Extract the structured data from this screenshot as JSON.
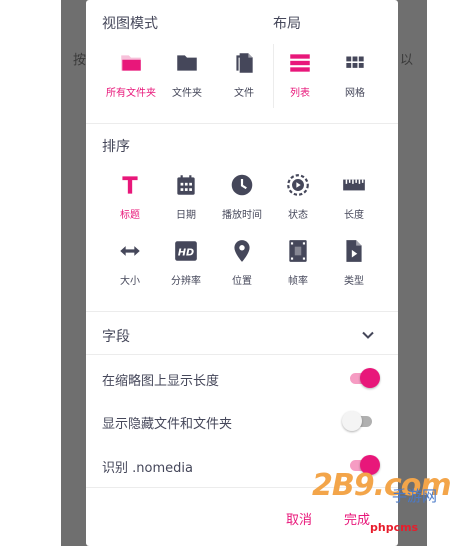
{
  "background": {
    "left_text": "按",
    "right_text": "以"
  },
  "view_mode": {
    "title": "视图模式",
    "items": [
      {
        "label": "所有文件夹",
        "icon": "folder-open-icon",
        "active": true
      },
      {
        "label": "文件夹",
        "icon": "folder-icon",
        "active": false
      },
      {
        "label": "文件",
        "icon": "file-icon",
        "active": false
      }
    ]
  },
  "layout": {
    "title": "布局",
    "items": [
      {
        "label": "列表",
        "icon": "list-icon",
        "active": true
      },
      {
        "label": "网格",
        "icon": "grid-icon",
        "active": false
      }
    ]
  },
  "sort": {
    "title": "排序",
    "items": [
      {
        "label": "标题",
        "icon": "title-icon",
        "active": true
      },
      {
        "label": "日期",
        "icon": "calendar-icon",
        "active": false
      },
      {
        "label": "播放时间",
        "icon": "clock-icon",
        "active": false
      },
      {
        "label": "状态",
        "icon": "status-icon",
        "active": false
      },
      {
        "label": "长度",
        "icon": "ruler-icon",
        "active": false
      },
      {
        "label": "大小",
        "icon": "size-icon",
        "active": false
      },
      {
        "label": "分辨率",
        "icon": "hd-icon",
        "active": false
      },
      {
        "label": "位置",
        "icon": "location-icon",
        "active": false
      },
      {
        "label": "帧率",
        "icon": "film-icon",
        "active": false
      },
      {
        "label": "类型",
        "icon": "filetype-icon",
        "active": false
      }
    ]
  },
  "fields": {
    "title": "字段"
  },
  "toggles": [
    {
      "label": "在缩略图上显示长度",
      "on": true
    },
    {
      "label": "显示隐藏文件和文件夹",
      "on": false
    },
    {
      "label": "识别 .nomedia",
      "on": true
    }
  ],
  "actions": {
    "cancel": "取消",
    "done": "完成"
  },
  "watermark": {
    "logo": "2B9.com",
    "sub": "手游网",
    "site": "phpcms"
  },
  "colors": {
    "accent": "#e8177a",
    "icon": "#45475a",
    "backdrop": "#6f6f6f"
  }
}
